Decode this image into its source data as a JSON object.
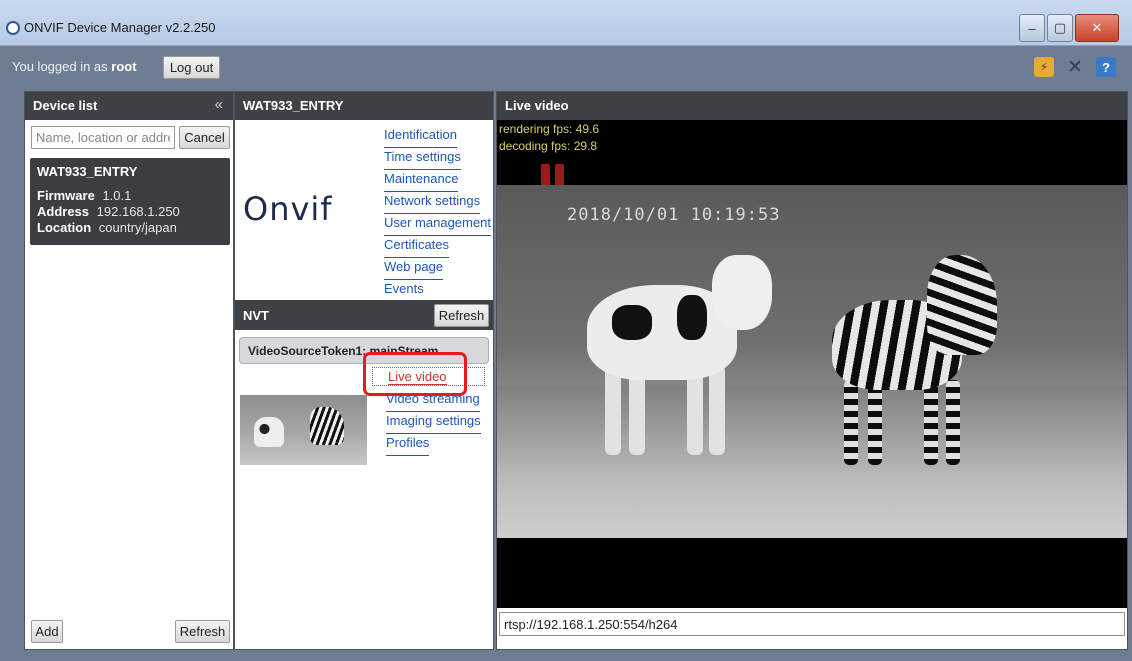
{
  "window": {
    "title": "ONVIF Device Manager v2.2.250",
    "minimize": "–",
    "maximize": "▢",
    "close": "✕"
  },
  "topbar": {
    "logged_in_prefix": "You logged in as",
    "user": "root",
    "logout_label": "Log out",
    "icons": [
      "plugin-icon",
      "tools-icon",
      "help-icon"
    ]
  },
  "device_list": {
    "title": "Device list",
    "collapse_glyph": "«",
    "search_placeholder": "Name, location or address",
    "cancel_label": "Cancel",
    "device": {
      "name": "WAT933_ENTRY",
      "firmware_label": "Firmware",
      "firmware": "1.0.1",
      "address_label": "Address",
      "address": "192.168.1.250",
      "location_label": "Location",
      "location": "country/japan"
    },
    "add_label": "Add",
    "refresh_label": "Refresh"
  },
  "device_panel": {
    "title": "WAT933_ENTRY",
    "logo_text": "Onvif",
    "links": [
      "Identification",
      "Time settings",
      "Maintenance",
      "Network settings",
      "User management",
      "Certificates",
      "Web page",
      "Events"
    ],
    "nvt_title": "NVT",
    "nvt_refresh_label": "Refresh",
    "video_source": "VideoSourceToken1: mainStream",
    "live_video_label": "Live video",
    "nvt_links": [
      "Video streaming",
      "Imaging settings",
      "Profiles"
    ]
  },
  "live_panel": {
    "title": "Live video",
    "rendering_fps": "rendering fps: 49.6",
    "decoding_fps": "decoding fps: 29.8",
    "timestamp": "2018/10/01 10:19:53",
    "stream_url": "rtsp://192.168.1.250:554/h264"
  },
  "colors": {
    "header": "#3e4146",
    "link": "#1f56b8",
    "highlight": "#e51c1c",
    "fps_text": "#d9d06a"
  }
}
